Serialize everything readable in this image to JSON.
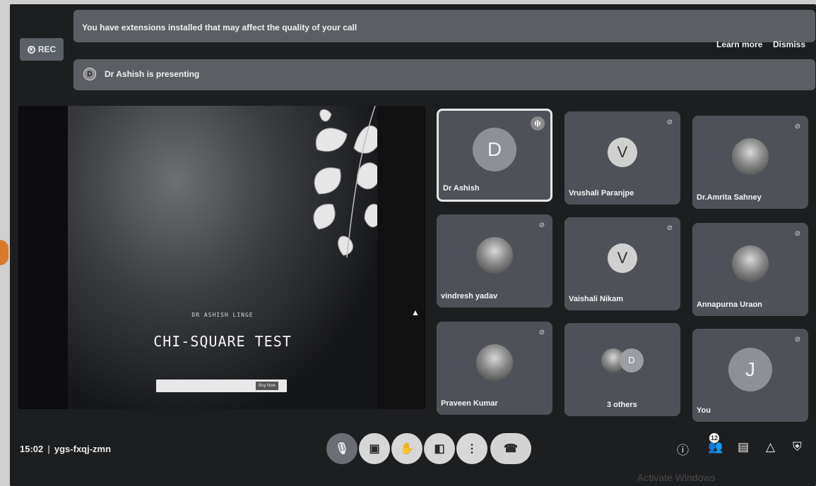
{
  "rec": {
    "label": "REC"
  },
  "banner": {
    "message": "You have extensions installed that may affect the quality of your call",
    "learn_more": "Learn more",
    "dismiss": "Dismiss"
  },
  "presenting": {
    "initial": "D",
    "text": "Dr Ashish is presenting"
  },
  "slide": {
    "author": "DR ASHISH LINGE",
    "title": "CHI-SQUARE TEST",
    "button": "Buy Now"
  },
  "tiles": [
    {
      "name": "Dr Ashish",
      "initial": "D",
      "type": "initial",
      "speaking": true
    },
    {
      "name": "Vrushali Paranjpe",
      "initial": "V",
      "type": "initial-small",
      "muted": true
    },
    {
      "name": "Dr.Amrita Sahney",
      "type": "photo",
      "muted": true
    },
    {
      "name": "vindresh yadav",
      "type": "photo",
      "muted": true
    },
    {
      "name": "Vaishali Nikam",
      "initial": "V",
      "type": "initial-small",
      "muted": true
    },
    {
      "name": "Annapurna Uraon",
      "type": "photo",
      "muted": true
    },
    {
      "name": "Praveen Kumar",
      "type": "photo",
      "muted": true
    },
    {
      "name": "3 others",
      "type": "others",
      "initial": "D"
    },
    {
      "name": "You",
      "initial": "J",
      "type": "initial",
      "muted": true
    }
  ],
  "footer": {
    "time": "15:02",
    "meeting_code": "ygs-fxqj-zmn",
    "participants_count": "12"
  },
  "watermark": "Activate Windows"
}
